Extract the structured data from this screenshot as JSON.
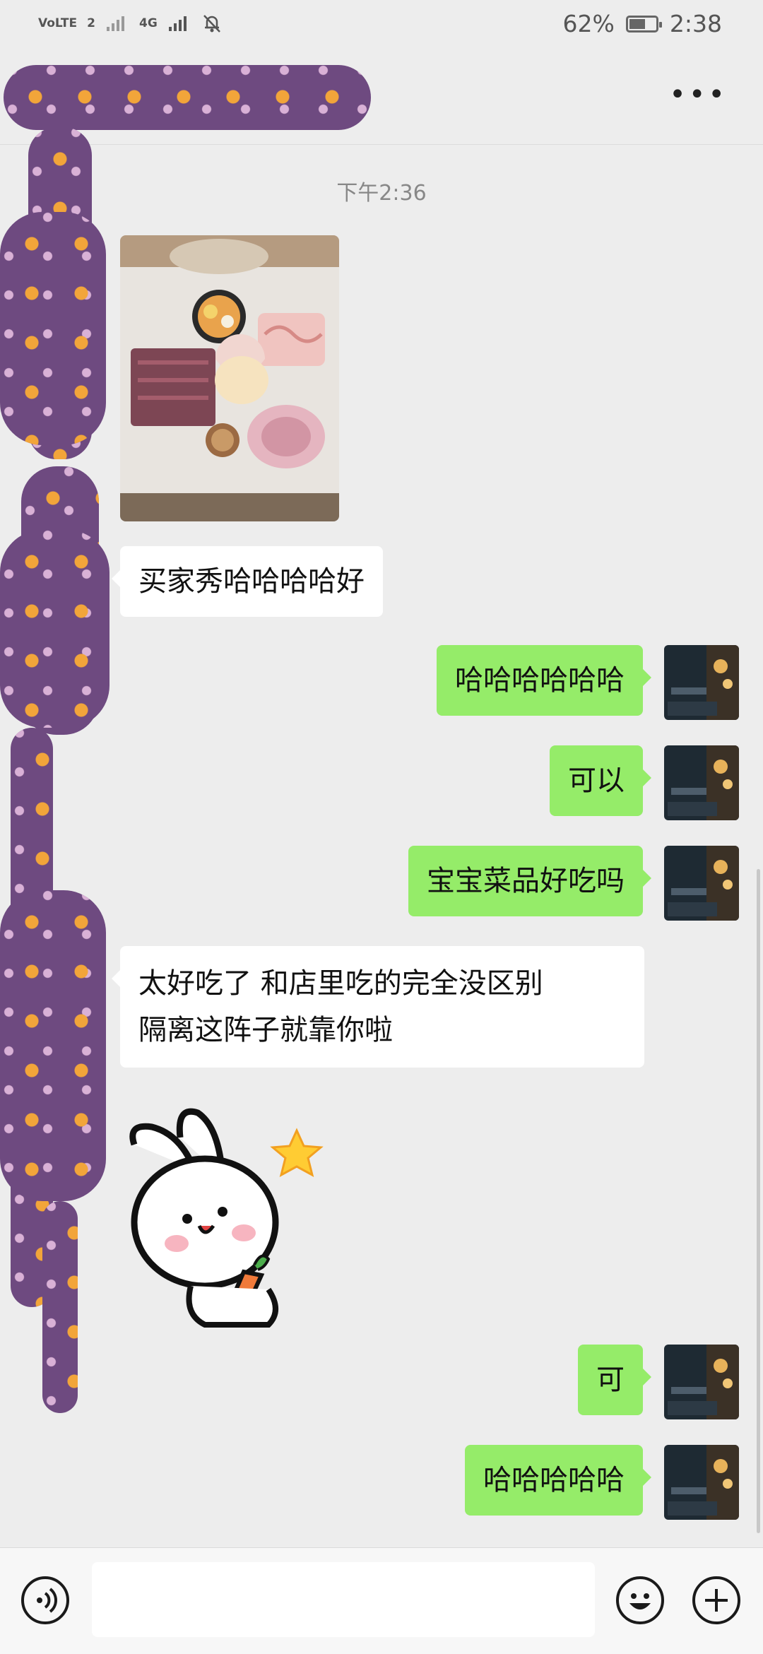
{
  "status_bar": {
    "network_left": "VoLTE",
    "sim_indicator": "2",
    "network_right": "4G",
    "battery_text": "62%",
    "battery_level": 0.62,
    "time": "2:38"
  },
  "header": {
    "more_icon": "more-icon"
  },
  "chat": {
    "timestamp": "下午2:36",
    "messages": [
      {
        "side": "left",
        "type": "image"
      },
      {
        "side": "left",
        "type": "text",
        "text": "买家秀哈哈哈哈好"
      },
      {
        "side": "right",
        "type": "text",
        "text": "哈哈哈哈哈哈"
      },
      {
        "side": "right",
        "type": "text",
        "text": "可以"
      },
      {
        "side": "right",
        "type": "text",
        "text": "宝宝菜品好吃吗"
      },
      {
        "side": "left",
        "type": "text",
        "lines": [
          "太好吃了 和店里吃的完全没区别",
          "隔离这阵子就靠你啦"
        ]
      },
      {
        "side": "left",
        "type": "sticker",
        "icon": "rabbit-carrot-sticker"
      },
      {
        "side": "right",
        "type": "text",
        "text": "可"
      },
      {
        "side": "right",
        "type": "text",
        "text": "哈哈哈哈哈"
      }
    ]
  },
  "input_bar": {
    "placeholder": "",
    "voice_icon": "voice-icon",
    "emoji_icon": "emoji-icon",
    "plus_icon": "plus-icon"
  },
  "colors": {
    "background": "#ededed",
    "my_bubble": "#95ec69",
    "their_bubble": "#ffffff"
  }
}
